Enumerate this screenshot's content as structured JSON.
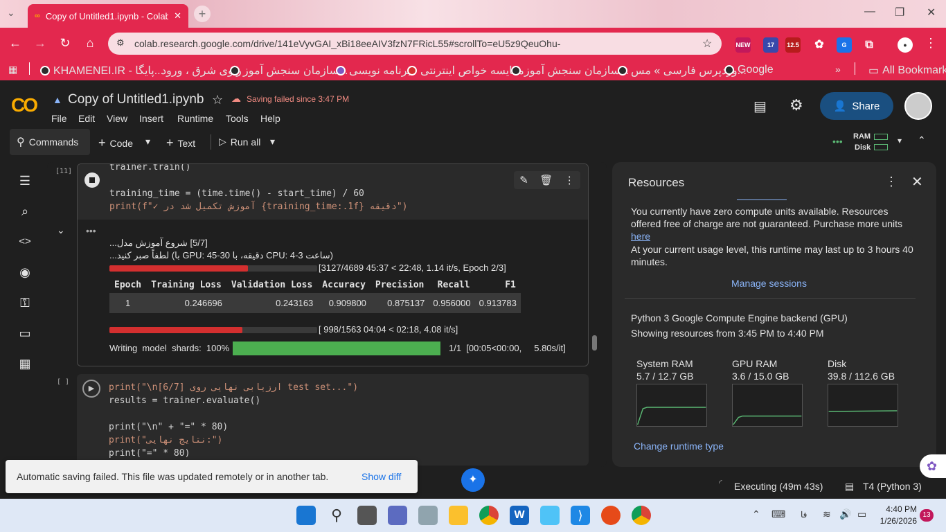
{
  "browser": {
    "tab_title": "Copy of Untitled1.ipynb - Colab",
    "url": "colab.research.google.com/drive/141eVyvGAI_xBi18eeAIV3fzN7FRicL55#scrollTo=eU5z9QeuOhu-",
    "extension_badges": [
      "NEW",
      "17",
      "12.5"
    ],
    "bookmarks": [
      "KHAMENEI.IR - پایگا...",
      "راوی شرق ، ورود",
      "سازمان سنجش آموز...",
      "برنامه نویسی",
      "مقایسه خواص اینترنتی",
      "سازمان سنجش آموز...",
      "وردپرس فارسی » مس...",
      "Google"
    ],
    "all_bookmarks": "All Bookmarks"
  },
  "colab": {
    "logo": "CO",
    "title": "Copy of Untitled1.ipynb",
    "save_status": "Saving failed since 3:47 PM",
    "menu": [
      "File",
      "Edit",
      "View",
      "Insert",
      "Runtime",
      "Tools",
      "Help"
    ],
    "share": "Share",
    "toolbar": {
      "commands": "Commands",
      "code": "Code",
      "text": "Text",
      "run_all": "Run all",
      "ram": "RAM",
      "disk": "Disk"
    }
  },
  "cell1": {
    "exec_count": "[11]",
    "code_lines": [
      "trainer.train()",
      "",
      "training_time = (time.time() - start_time) / 60",
      "print(f\"✓ آموزش تکمیل شد در {training_time:.1f} دقیقه\")"
    ],
    "output_line1": "[5/7] شروع آموزش مدل...",
    "output_line2": "(ساعت 3-4 :CPU دقیقه، با 30-45 :GPU با) لطفاً صبر کنید...",
    "progress1": {
      "fraction": 0.667,
      "text": "[3127/4689 45:37 < 22:48, 1.14 it/s, Epoch 2/3]"
    },
    "table": {
      "headers": [
        "Epoch",
        "Training Loss",
        "Validation Loss",
        "Accuracy",
        "Precision",
        "Recall",
        "F1"
      ],
      "rows": [
        [
          "1",
          "0.246696",
          "0.243163",
          "0.909800",
          "0.875137",
          "0.956000",
          "0.913783"
        ]
      ]
    },
    "progress2": {
      "fraction": 0.639,
      "text": "[ 998/1563 04:04 < 02:18, 4.08 it/s]"
    },
    "shards": {
      "label": "Writing  model  shards:  100%",
      "fraction": 1.0,
      "text": "1/1  [00:05<00:00,     5.80s/it]"
    }
  },
  "cell2": {
    "exec_count": "[ ]",
    "code_lines": [
      "print(\"\\n[6/7] ارزیابی نهایی روی test set...\")",
      "results = trainer.evaluate()",
      "",
      "print(\"\\n\" + \"=\" * 80)",
      "print(\"نتایج نهایی:\")",
      "print(\"=\" * 80)"
    ]
  },
  "resources": {
    "title": "Resources",
    "para1": "You currently have zero compute units available. Resources offered free of charge are not guaranteed. Purchase more units",
    "here": "here",
    "para2": "At your current usage level, this runtime may last up to 3 hours 40 minutes.",
    "manage": "Manage sessions",
    "backend": "Python 3 Google Compute Engine backend (GPU)",
    "range": "Showing resources from 3:45 PM to 4:40 PM",
    "meters": [
      {
        "name": "System RAM",
        "value": "5.7 / 12.7 GB",
        "level": 0.45
      },
      {
        "name": "GPU RAM",
        "value": "3.6 / 15.0 GB",
        "level": 0.24
      },
      {
        "name": "Disk",
        "value": "39.8 / 112.6 GB",
        "level": 0.35
      }
    ],
    "change": "Change runtime type"
  },
  "toast": {
    "message": "Automatic saving failed. This file was updated remotely or in another tab.",
    "action": "Show diff"
  },
  "status": {
    "executing": "Executing (49m 43s)",
    "runtime": "T4 (Python 3)"
  },
  "taskbar": {
    "lang": "فا",
    "time": "4:40 PM",
    "date": "1/26/2026",
    "notif": "13"
  }
}
